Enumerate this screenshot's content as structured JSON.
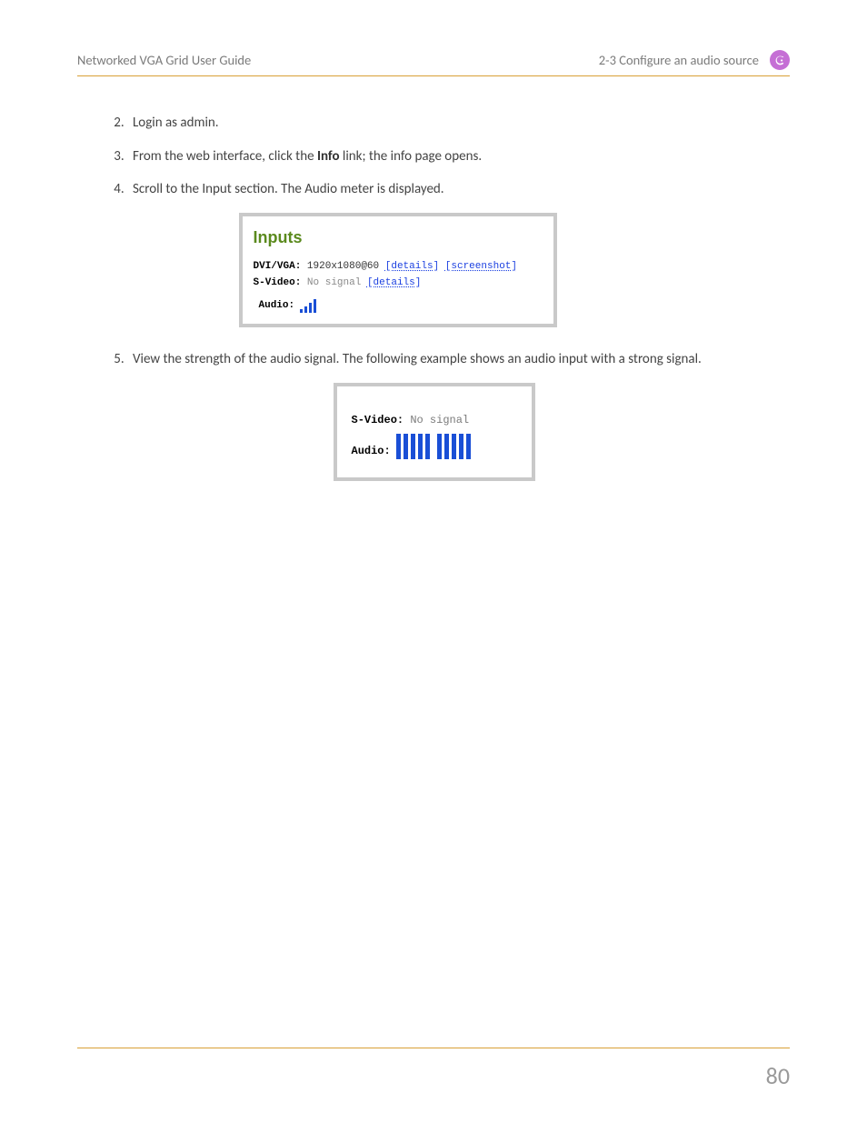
{
  "header": {
    "left": "Networked VGA Grid User Guide",
    "right": "2-3 Configure an audio source"
  },
  "steps": {
    "s2": "Login as admin.",
    "s3a": "From the web interface, click the ",
    "s3b": "Info",
    "s3c": " link; the info page opens.",
    "s4": "Scroll to the Input section. The Audio meter is displayed.",
    "s5": "View the strength of the audio signal. The following example shows an audio input with a strong signal."
  },
  "fig1": {
    "title": "Inputs",
    "dvi_label": "DVI/VGA:",
    "dvi_value": "1920x1080@60",
    "details": "[details]",
    "screenshot": "[screenshot]",
    "svideo_label": "S-Video:",
    "no_signal": "No signal",
    "audio_label": "Audio:"
  },
  "fig2": {
    "svideo_label": "S-Video:",
    "no_signal": "No signal",
    "audio_label": "Audio:"
  },
  "page_number": "80"
}
